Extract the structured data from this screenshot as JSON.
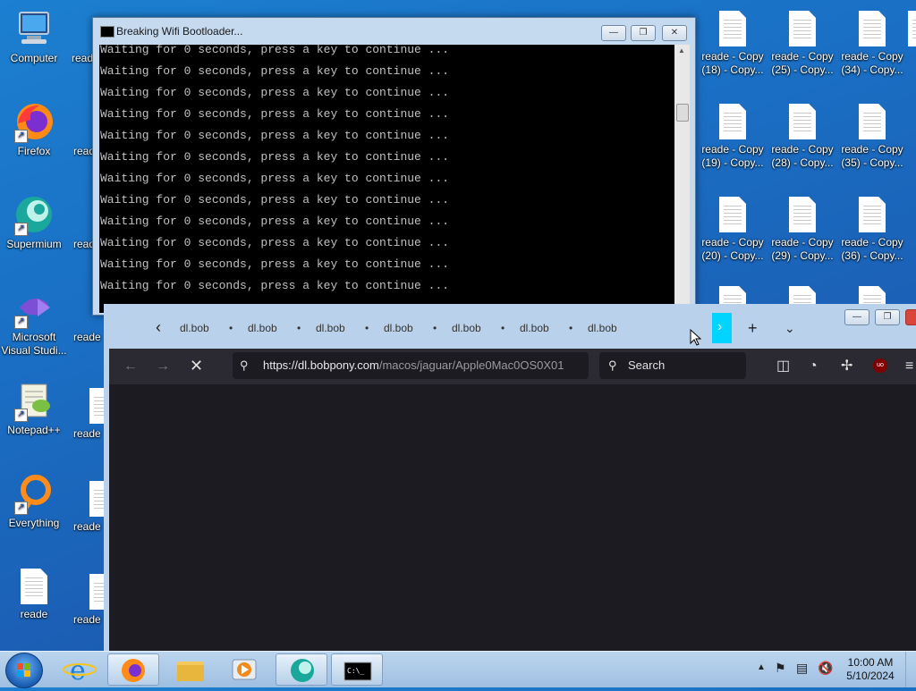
{
  "desktop": {
    "left_icons": [
      {
        "label": "Computer"
      },
      {
        "label": "Firefox"
      },
      {
        "label": "Supermium"
      },
      {
        "label": "Microsoft Visual Studi..."
      },
      {
        "label": "Notepad++"
      },
      {
        "label": "Everything"
      },
      {
        "label": "reade"
      }
    ],
    "partial_label": "reade",
    "right_icons": [
      {
        "label": "reade - Copy (18) - Copy..."
      },
      {
        "label": "reade - Copy (25) - Copy..."
      },
      {
        "label": "reade - Copy (34) - Copy..."
      },
      {
        "label": "reade - Copy (19) - Copy..."
      },
      {
        "label": "reade - Copy (28) - Copy..."
      },
      {
        "label": "reade - Copy (35) - Copy..."
      },
      {
        "label": "reade - Copy (20) - Copy..."
      },
      {
        "label": "reade - Copy (29) - Copy..."
      },
      {
        "label": "reade - Copy (36) - Copy..."
      }
    ]
  },
  "cmd_window": {
    "title": "Breaking Wifi Bootloader...",
    "lines": [
      "Waiting for 0 seconds, press a key to continue ...",
      "Waiting for 0 seconds, press a key to continue ...",
      "Waiting for 0 seconds, press a key to continue ...",
      "Waiting for 0 seconds, press a key to continue ...",
      "Waiting for 0 seconds, press a key to continue ...",
      "Waiting for 0 seconds, press a key to continue ...",
      "Waiting for 0 seconds, press a key to continue ...",
      "Waiting for 0 seconds, press a key to continue ...",
      "Waiting for 0 seconds, press a key to continue ...",
      "Waiting for 0 seconds, press a key to continue ...",
      "Waiting for 0 seconds, press a key to continue ...",
      "Waiting for 0 seconds, press a key to continue ..."
    ]
  },
  "browser": {
    "tabs": [
      "dl.bob",
      "dl.bob",
      "dl.bob",
      "dl.bob",
      "dl.bob",
      "dl.bob",
      "dl.bob"
    ],
    "url_host": "https://dl.bobpony.com",
    "url_path": "/macos/jaguar/Apple0Mac0OS0X01",
    "search_placeholder": "Search",
    "accent_color": "#00d4ff"
  },
  "taskbar": {
    "time": "10:00 AM",
    "date": "5/10/2024"
  }
}
